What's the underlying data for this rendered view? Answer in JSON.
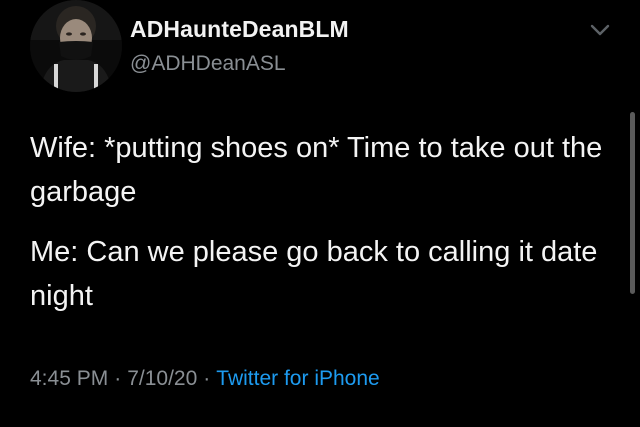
{
  "tweet": {
    "display_name": "ADHaunteDeanBLM",
    "handle": "@ADHDeanASL",
    "menu_icon": "chevron-down-icon",
    "paragraphs": [
      "Wife: *putting shoes on* Time to take out the garbage",
      "Me: Can we please go back to calling it date night"
    ],
    "time": "4:45 PM",
    "date": "7/10/20",
    "separator": "·",
    "source": "Twitter for iPhone"
  },
  "colors": {
    "background": "#000000",
    "text": "#f4f4f4",
    "secondary": "#8a8f94",
    "link": "#1d9bf0"
  }
}
